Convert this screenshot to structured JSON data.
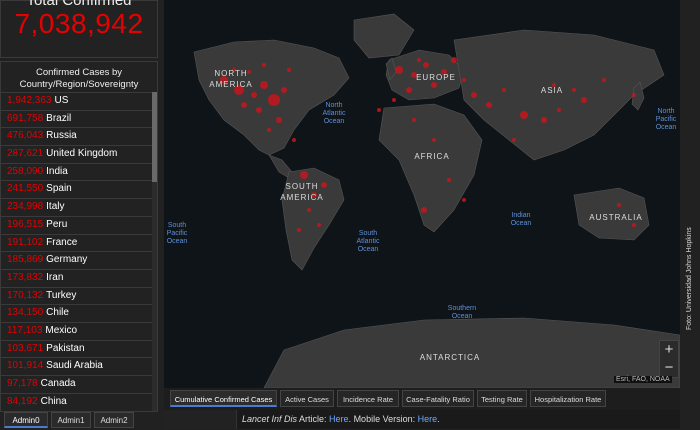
{
  "total": {
    "label": "Total Confirmed",
    "value": "7,038,942"
  },
  "list": {
    "title_line1": "Confirmed Cases by",
    "title_line2": "Country/Region/Sovereignty",
    "rows": [
      {
        "num": "1,942,363",
        "name": "US"
      },
      {
        "num": "691,758",
        "name": "Brazil"
      },
      {
        "num": "476,043",
        "name": "Russia"
      },
      {
        "num": "287,621",
        "name": "United Kingdom"
      },
      {
        "num": "258,090",
        "name": "India"
      },
      {
        "num": "241,550",
        "name": "Spain"
      },
      {
        "num": "234,998",
        "name": "Italy"
      },
      {
        "num": "196,515",
        "name": "Peru"
      },
      {
        "num": "191,102",
        "name": "France"
      },
      {
        "num": "185,869",
        "name": "Germany"
      },
      {
        "num": "173,832",
        "name": "Iran"
      },
      {
        "num": "170,132",
        "name": "Turkey"
      },
      {
        "num": "134,150",
        "name": "Chile"
      },
      {
        "num": "117,103",
        "name": "Mexico"
      },
      {
        "num": "103,671",
        "name": "Pakistan"
      },
      {
        "num": "101,914",
        "name": "Saudi Arabia"
      },
      {
        "num": "97,178",
        "name": "Canada"
      },
      {
        "num": "84,192",
        "name": "China"
      }
    ]
  },
  "admin_tabs": [
    "Admin0",
    "Admin1",
    "Admin2"
  ],
  "map": {
    "continents": {
      "north_america_1": "NORTH",
      "north_america_2": "AMERICA",
      "south_america_1": "SOUTH",
      "south_america_2": "AMERICA",
      "europe": "EUROPE",
      "asia": "ASIA",
      "africa": "AFRICA",
      "australia": "AUSTRALIA",
      "antarctica": "ANTARCTICA"
    },
    "oceans": {
      "north_atlantic": [
        "North",
        "Atlantic",
        "Ocean"
      ],
      "south_atlantic": [
        "South",
        "Atlantic",
        "Ocean"
      ],
      "south_pacific": [
        "South",
        "Pacific",
        "Ocean"
      ],
      "north_pacific": [
        "North",
        "Pacific",
        "Ocean"
      ],
      "indian": [
        "Indian",
        "Ocean"
      ],
      "southern": [
        "Southern",
        "Ocean"
      ]
    },
    "zoom_in": "+",
    "zoom_out": "−",
    "attribution": "Esri, FAO, NOAA",
    "credit": "Foto: Universidad Johns Hopkins"
  },
  "tabs": [
    "Cumulative Confirmed Cases",
    "Active Cases",
    "Incidence Rate",
    "Case-Fatality Ratio",
    "Testing Rate",
    "Hospitalization Rate"
  ],
  "bottom": {
    "lancet_prefix": "Lancet Inf Dis",
    "lancet_mid": " Article: ",
    "here1": "Here",
    "mobile": ". Mobile Version: ",
    "here2": "Here",
    "end": "."
  }
}
